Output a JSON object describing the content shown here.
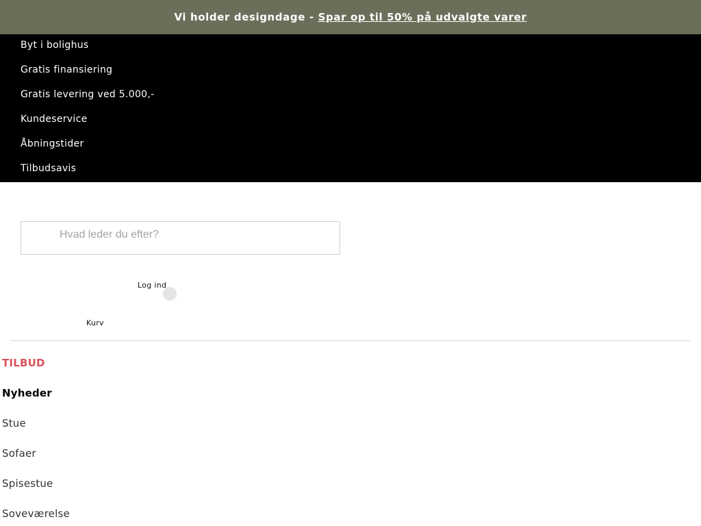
{
  "promo": {
    "text": "Vi holder designdage -",
    "link": "Spar op til 50% på udvalgte varer"
  },
  "top_links": [
    "Byt i bolighus",
    "Gratis finansiering",
    "Gratis levering ved 5.000,-",
    "Kundeservice",
    "Åbningstider",
    "Tilbudsavis"
  ],
  "search": {
    "placeholder": "Hvad leder du efter?",
    "value": ""
  },
  "account": {
    "login_label": "Log ind",
    "cart_label": "Kurv"
  },
  "main_nav": [
    "TILBUD",
    "Nyheder",
    "Stue",
    "Sofaer",
    "Spisestue",
    "Soveværelse"
  ],
  "colors": {
    "promo_bg": "#6b6e59",
    "top_links_bg": "#000000",
    "tilbud": "#d9525b"
  }
}
